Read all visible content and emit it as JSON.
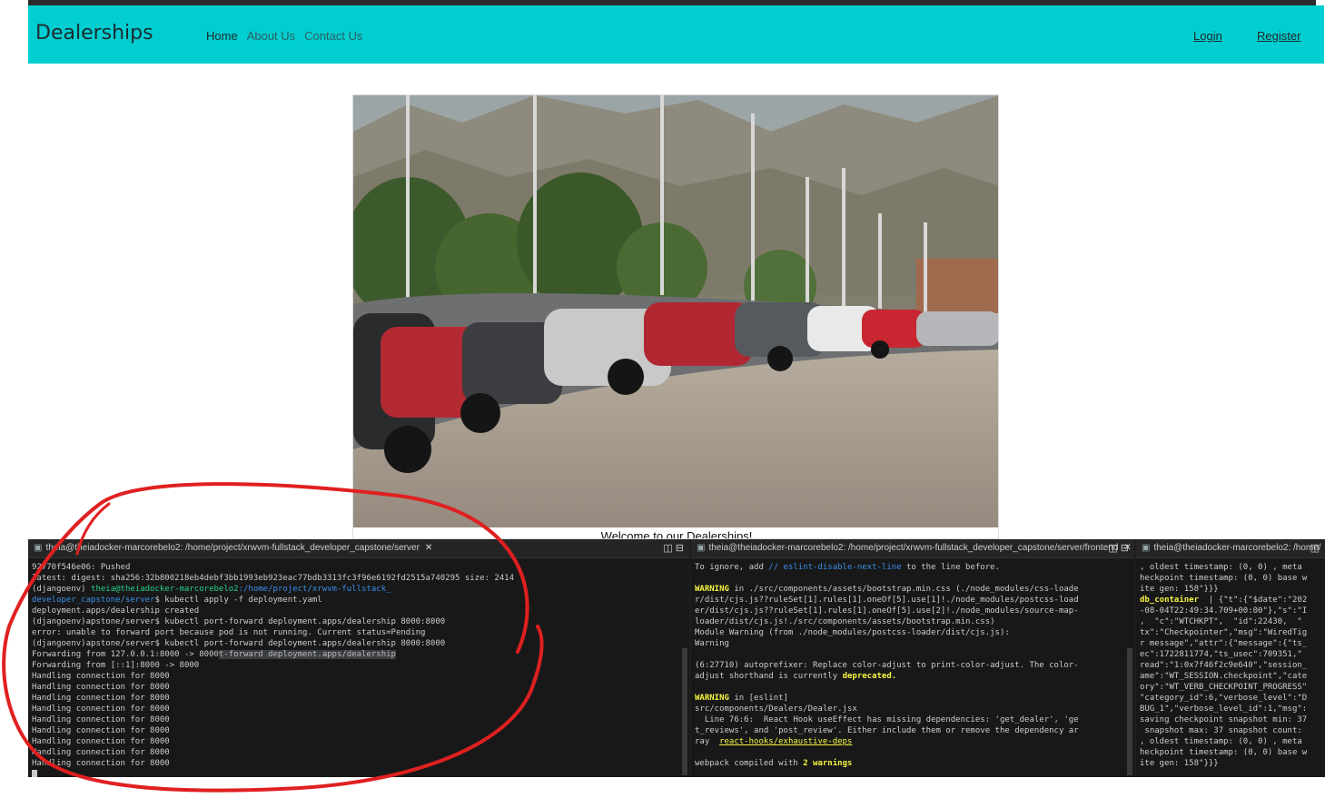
{
  "navbar": {
    "brand": "Dealerships",
    "links": [
      "Home",
      "About Us",
      "Contact Us"
    ],
    "login": "Login",
    "register": "Register",
    "bg_color": "#00ced1"
  },
  "hero": {
    "welcome": "Welcome to our Dealerships!"
  },
  "terminals": [
    {
      "title": "theia@theiadocker-marcorebelo2: /home/project/xrwvm-fullstack_developer_capstone/server",
      "lines": {
        "l1": "92770f546e06: Pushed",
        "l2": "latest: digest: sha256:32b800218eb4debf3bb1993eb923eac77bdb3313fc3f96e6192fd2515a740295 size: 2414",
        "l3a": "(djangoenv) ",
        "l3b": "theia@theiadocker-marcorebelo2",
        "l3c": ":/home/project/xrwvm-fullstack_",
        "l4a": "developer_capstone/server",
        "l4b": "$ kubectl apply -f deployment.yaml",
        "l5": "deployment.apps/dealership created",
        "l6": "(djangoenv)apstone/server$ kubectl port-forward deployment.apps/dealership 8000:8000",
        "l7": "error: unable to forward port because pod is not running. Current status=Pending",
        "l8": "(djangoenv)apstone/server$ kubectl port-forward deployment.apps/dealership 8000:8000",
        "l9a": "Forwarding from 127.0.0.1:8000 -> 8000",
        "l9b": "t-forward deployment.apps/dealership",
        "l10": "Forwarding from [::1]:8000 -> 8000",
        "handling": "Handling connection for 8000"
      }
    },
    {
      "title": "theia@theiadocker-marcorebelo2: /home/project/xrwvm-fullstack_developer_capstone/server/frontend",
      "lines": {
        "l1a": "To ignore, add ",
        "l1b": "// eslint-disable-next-line",
        "l1c": " to the line before.",
        "w1a": "WARNING",
        "w1b": " in ./src/components/assets/bootstrap.min.css (./node_modules/css-loade",
        "w2": "r/dist/cjs.js??ruleSet[1].rules[1].oneOf[5].use[1]!./node_modules/postcss-load",
        "w3": "er/dist/cjs.js??ruleSet[1].rules[1].oneOf[5].use[2]!./node_modules/source-map-",
        "w4": "loader/dist/cjs.js!./src/components/assets/bootstrap.min.css)",
        "w5": "Module Warning (from ./node_modules/postcss-loader/dist/cjs.js):",
        "w6": "Warning",
        "a1": "(6:27710) autoprefixer: Replace color-adjust to print-color-adjust. The color-",
        "a2a": "adjust shorthand is currently ",
        "a2b": "deprecated.",
        "e1a": "WARNING",
        "e1b": " in [eslint]",
        "e2": "src/components/Dealers/Dealer.jsx",
        "e3": "  Line 76:6:  React Hook useEffect has missing dependencies: 'get_dealer', 'ge",
        "e4": "t_reviews', and 'post_review'. Either include them or remove the dependency ar",
        "e5a": "ray  ",
        "e5b": "react-hooks/exhaustive-deps",
        "c1a": "webpack compiled with ",
        "c1b": "2 warnings"
      }
    },
    {
      "title": "theia@theiadocker-marcorebelo2: /home/",
      "lines": {
        "m1": ", oldest timestamp: (0, 0) , meta",
        "m2": "heckpoint timestamp: (0, 0) base w",
        "m3": "ite gen: 158\"}}}",
        "m4a": "db_container",
        "m4b": "  | {\"t\":{\"$date\":\"202",
        "m5": "-08-04T22:49:34.709+00:00\"},\"s\":\"I",
        "m6": ",  \"c\":\"WTCHKPT\",  \"id\":22430,  \"",
        "m7": "tx\":\"Checkpointer\",\"msg\":\"WiredTig",
        "m8": "r message\",\"attr\":{\"message\":{\"ts_",
        "m9": "ec\":1722811774,\"ts_usec\":709351,\"",
        "m10": "read\":\"1:0x7f46f2c9e640\",\"session_",
        "m11": "ame\":\"WT_SESSION.checkpoint\",\"cate",
        "m12": "ory\":\"WT_VERB_CHECKPOINT_PROGRESS\"",
        "m13": "\"category_id\":6,\"verbose_level\":\"D",
        "m14": "BUG_1\",\"verbose_level_id\":1,\"msg\":",
        "m15": "saving checkpoint snapshot min: 37",
        "m16": " snapshot max: 37 snapshot count:",
        "m17": ", oldest timestamp: (0, 0) , meta",
        "m18": "heckpoint timestamp: (0, 0) base w",
        "m19": "ite gen: 158\"}}}"
      }
    }
  ]
}
